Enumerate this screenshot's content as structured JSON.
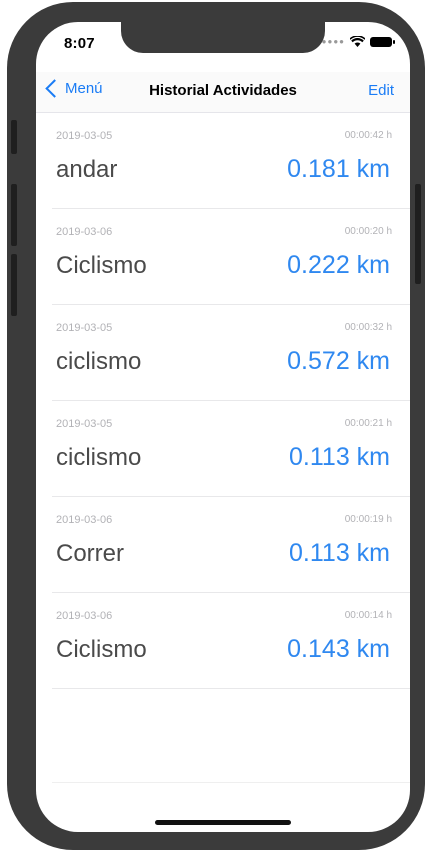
{
  "status_bar": {
    "time": "8:07",
    "icons": [
      "signal-dots",
      "wifi-icon",
      "battery-icon"
    ]
  },
  "navbar": {
    "back_label": "Menú",
    "title": "Historial Actividades",
    "edit_label": "Edit"
  },
  "colors": {
    "accent": "#1a7cf5",
    "distance": "#2f88f0",
    "muted": "#b2b2b6",
    "text": "#4a4a4a"
  },
  "activities": [
    {
      "date": "2019-03-05",
      "duration": "00:00:42 h",
      "name": "andar",
      "distance": "0.181 km"
    },
    {
      "date": "2019-03-06",
      "duration": "00:00:20 h",
      "name": "Ciclismo",
      "distance": "0.222 km"
    },
    {
      "date": "2019-03-05",
      "duration": "00:00:32 h",
      "name": "ciclismo",
      "distance": "0.572 km"
    },
    {
      "date": "2019-03-05",
      "duration": "00:00:21 h",
      "name": "ciclismo",
      "distance": "0.113 km"
    },
    {
      "date": "2019-03-06",
      "duration": "00:00:19 h",
      "name": "Correr",
      "distance": "0.113 km"
    },
    {
      "date": "2019-03-06",
      "duration": "00:00:14 h",
      "name": "Ciclismo",
      "distance": "0.143 km"
    }
  ]
}
